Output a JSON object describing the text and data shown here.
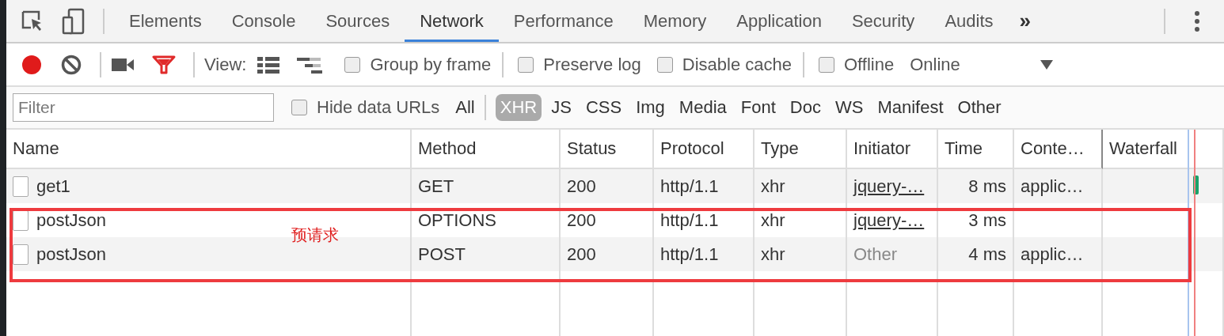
{
  "tabs": [
    {
      "label": "Elements",
      "selected": false
    },
    {
      "label": "Console",
      "selected": false
    },
    {
      "label": "Sources",
      "selected": false
    },
    {
      "label": "Network",
      "selected": true
    },
    {
      "label": "Performance",
      "selected": false
    },
    {
      "label": "Memory",
      "selected": false
    },
    {
      "label": "Application",
      "selected": false
    },
    {
      "label": "Security",
      "selected": false
    },
    {
      "label": "Audits",
      "selected": false
    }
  ],
  "more_tabs": "»",
  "toolbar": {
    "recording": true,
    "filter_active": true,
    "view_label": "View:",
    "checkboxes": [
      {
        "label": "Group by frame",
        "checked": false,
        "separator_before": false
      },
      {
        "label": "Preserve log",
        "checked": false,
        "separator_before": true
      },
      {
        "label": "Disable cache",
        "checked": false,
        "separator_before": false
      },
      {
        "label": "Offline",
        "checked": false,
        "separator_before": true
      }
    ],
    "throttling": "Online"
  },
  "filter_bar": {
    "placeholder": "Filter",
    "hide_data_urls": {
      "label": "Hide data URLs",
      "checked": false
    },
    "types": [
      {
        "label": "All",
        "selected": false
      },
      {
        "label": "XHR",
        "selected": true
      },
      {
        "label": "JS",
        "selected": false
      },
      {
        "label": "CSS",
        "selected": false
      },
      {
        "label": "Img",
        "selected": false
      },
      {
        "label": "Media",
        "selected": false
      },
      {
        "label": "Font",
        "selected": false
      },
      {
        "label": "Doc",
        "selected": false
      },
      {
        "label": "WS",
        "selected": false
      },
      {
        "label": "Manifest",
        "selected": false
      },
      {
        "label": "Other",
        "selected": false
      }
    ]
  },
  "table": {
    "columns": [
      "Name",
      "Method",
      "Status",
      "Protocol",
      "Type",
      "Initiator",
      "Time",
      "Conte…",
      "Waterfall"
    ],
    "rows": [
      {
        "name": "get1",
        "method": "GET",
        "status": "200",
        "protocol": "http/1.1",
        "type": "xhr",
        "initiator": "jquery-…",
        "initiator_link": true,
        "time": "8 ms",
        "content": "applic…",
        "waterfall_bar": true
      },
      {
        "name": "postJson",
        "method": "OPTIONS",
        "status": "200",
        "protocol": "http/1.1",
        "type": "xhr",
        "initiator": "jquery-…",
        "initiator_link": true,
        "time": "3 ms",
        "waterfall_bar": false
      },
      {
        "name": "postJson",
        "method": "POST",
        "status": "200",
        "protocol": "http/1.1",
        "type": "xhr",
        "initiator": "Other",
        "initiator_link": false,
        "time": "4 ms",
        "content": "applic…",
        "waterfall_bar": false
      }
    ]
  },
  "annotation": {
    "label": "预请求"
  }
}
